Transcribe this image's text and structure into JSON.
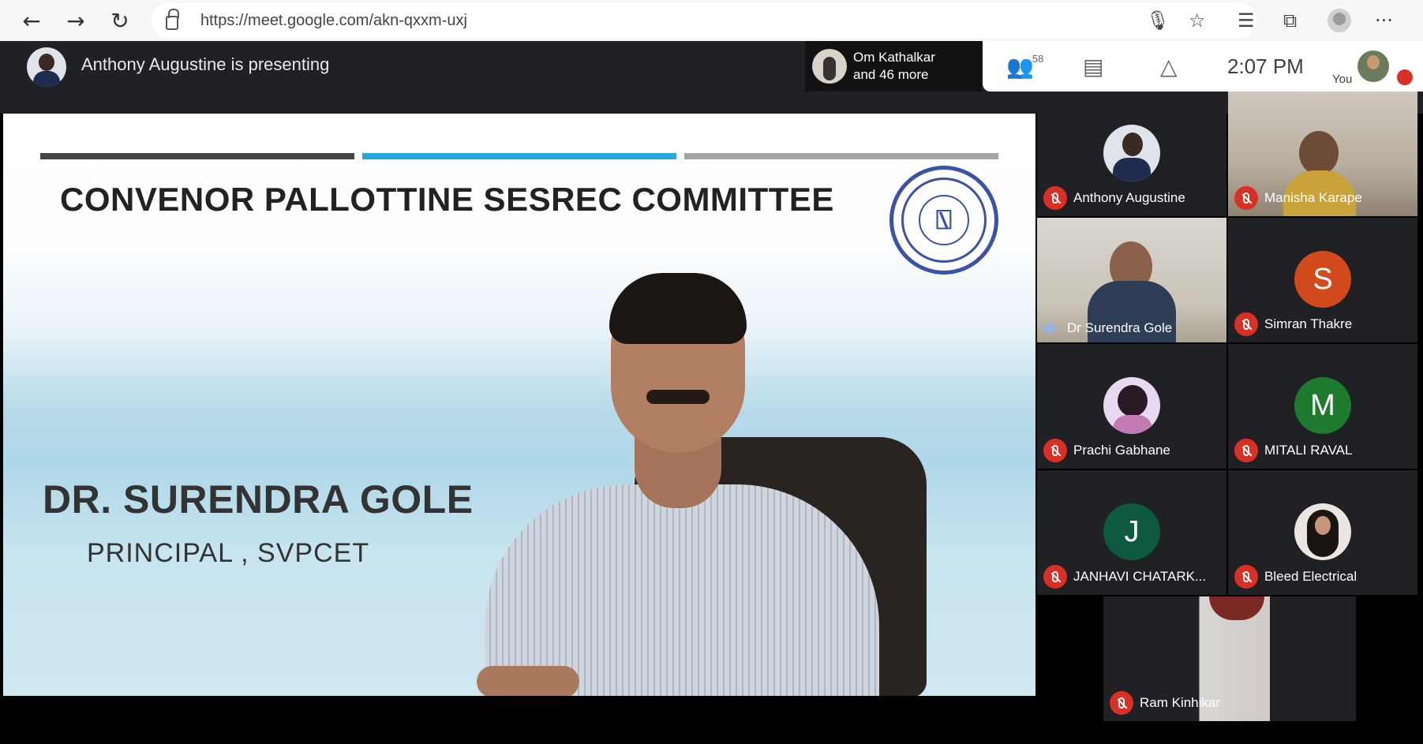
{
  "browser": {
    "back_glyph": "←",
    "forward_glyph": "→",
    "reload_glyph": "↻",
    "url": "https://meet.google.com/akn-qxxm-uxj",
    "mic_glyph": "🎙",
    "star_glyph": "☆",
    "favorites_glyph": "☰",
    "collections_glyph": "⧉",
    "more_glyph": "···"
  },
  "meet": {
    "presenting_text": "Anthony Augustine is presenting",
    "others_line1": "Om Kathalkar",
    "others_line2": "and 46 more",
    "people_count": "58",
    "people_glyph": "👥",
    "chat_glyph": "▤",
    "activities_glyph": "△",
    "time": "2:07  PM",
    "you_label": "You"
  },
  "slide": {
    "title": "CONVENOR PALLOTTINE SESREC COMMITTEE",
    "name": "DR. SURENDRA GOLE",
    "role": "PRINCIPAL , SVPCET",
    "colors": {
      "bar1": "#444444",
      "bar2": "#29a8dc",
      "bar3": "#a5a5a5"
    }
  },
  "participants": [
    {
      "name": "Anthony Augustine",
      "type": "photo",
      "muted": true
    },
    {
      "name": "Manisha Karape",
      "type": "video",
      "muted": true
    },
    {
      "name": "Dr Surendra Gole",
      "type": "video",
      "muted": false,
      "speaking": true
    },
    {
      "name": "Simran Thakre",
      "type": "initial",
      "initial": "S",
      "color": "#d24a1b",
      "muted": true
    },
    {
      "name": "Prachi Gabhane",
      "type": "photo",
      "muted": true
    },
    {
      "name": "MITALI RAVAL",
      "type": "initial",
      "initial": "M",
      "color": "#1e7a2e",
      "muted": true
    },
    {
      "name": "JANHAVI CHATARK...",
      "type": "initial",
      "initial": "J",
      "color": "#0f5a3e",
      "muted": true
    },
    {
      "name": "Bleed Electrical",
      "type": "photo",
      "muted": true
    },
    {
      "name": "Ram Kinhikar",
      "type": "video",
      "muted": true
    }
  ]
}
